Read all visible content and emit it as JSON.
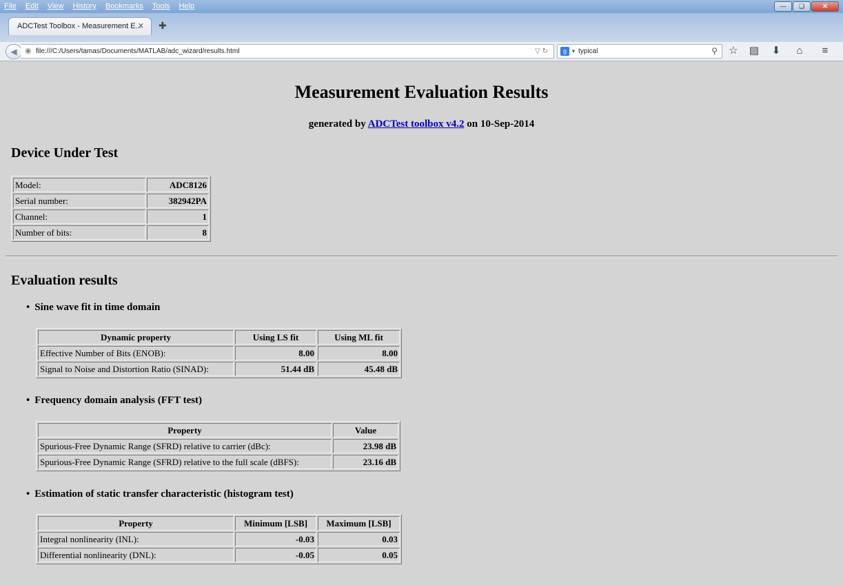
{
  "browser": {
    "menu": [
      "File",
      "Edit",
      "View",
      "History",
      "Bookmarks",
      "Tools",
      "Help"
    ],
    "tab_title": "ADCTest Toolbox - Measurement E...",
    "url": "file:///C:/Users/tamas/Documents/MATLAB/adc_wizard/results.html",
    "search_value": "typical"
  },
  "page": {
    "title": "Measurement Evaluation Results",
    "generated_prefix": "generated by",
    "generated_link": "ADCTest toolbox v4.2",
    "generated_suffix": "on 10-Sep-2014"
  },
  "dut": {
    "heading": "Device Under Test",
    "rows": [
      {
        "label": "Model:",
        "value": "ADC8126"
      },
      {
        "label": "Serial number:",
        "value": "382942PA"
      },
      {
        "label": "Channel:",
        "value": "1"
      },
      {
        "label": "Number of bits:",
        "value": "8"
      }
    ]
  },
  "evaluation": {
    "heading": "Evaluation results",
    "sine": {
      "title": "Sine wave fit in time domain",
      "headers": [
        "Dynamic property",
        "Using LS fit",
        "Using ML fit"
      ],
      "rows": [
        {
          "label": "Effective Number of Bits (ENOB):",
          "ls": "8.00",
          "ml": "8.00"
        },
        {
          "label": "Signal to Noise and Distortion Ratio (SINAD):",
          "ls": "51.44 dB",
          "ml": "45.48 dB"
        }
      ]
    },
    "fft": {
      "title": "Frequency domain analysis (FFT test)",
      "headers": [
        "Property",
        "Value"
      ],
      "rows": [
        {
          "label": "Spurious-Free Dynamic Range (SFRD) relative to carrier (dBc):",
          "value": "23.98 dB"
        },
        {
          "label": "Spurious-Free Dynamic Range (SFRD) relative to the full scale (dBFS):",
          "value": "23.16 dB"
        }
      ]
    },
    "hist": {
      "title": "Estimation of static transfer characteristic (histogram test)",
      "headers": [
        "Property",
        "Minimum [LSB]",
        "Maximum [LSB]"
      ],
      "rows": [
        {
          "label": "Integral nonlinearity (INL):",
          "min": "-0.03",
          "max": "0.03"
        },
        {
          "label": "Differential nonlinearity (DNL):",
          "min": "-0.05",
          "max": "0.05"
        }
      ]
    }
  }
}
